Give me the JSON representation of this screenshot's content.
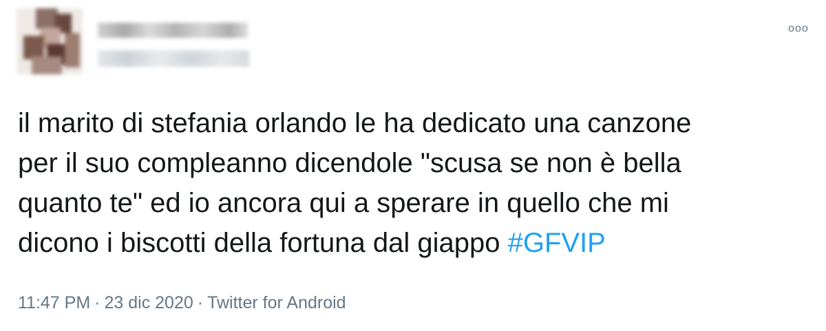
{
  "tweet": {
    "author": {
      "avatar": "blurred-profile-photo"
    },
    "more_icon": "more-options-icon",
    "more_glyph": "ooo",
    "text_lines": [
      "il marito di stefania orlando le ha dedicato una canzone",
      "per il suo compleanno dicendole \"scusa se non è bella",
      "quanto te\" ed io ancora qui a sperare in quello che mi",
      "dicono i biscotti della fortuna dal giappo "
    ],
    "hashtag": "#GFVIP",
    "time": "11:47 PM",
    "date": "23 dic 2020",
    "source": "Twitter for Android",
    "separator": "·",
    "colors": {
      "text": "#14171a",
      "meta": "#657786",
      "hashtag": "#1da1f2",
      "background": "#ffffff"
    }
  }
}
